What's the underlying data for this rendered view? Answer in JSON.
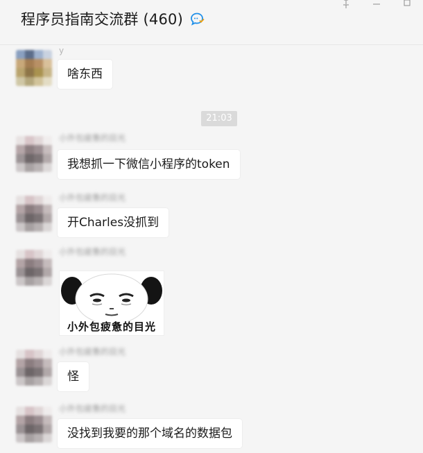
{
  "header": {
    "title": "程序员指南交流群",
    "member_count": "(460)",
    "icons": [
      "chat-bubble-icon",
      "pin-icon",
      "minimize-icon",
      "maximize-icon"
    ]
  },
  "timestamp": "21:03",
  "messages": [
    {
      "sender": "y",
      "text": "啥东西"
    },
    {
      "sender": "小外包疲惫的目光",
      "text": "我想抓一下微信小程序的token"
    },
    {
      "sender": "小外包疲惫的目光",
      "text": "开Charles没抓到"
    },
    {
      "sender": "小外包疲惫的目光",
      "sticker_caption": "小外包疲惫的目光"
    },
    {
      "sender": "小外包疲惫的目光",
      "text": "怪"
    },
    {
      "sender": "小外包疲惫的目光",
      "text": "没找到我要的那个域名的数据包"
    }
  ],
  "colors": {
    "background": "#f5f5f5",
    "bubble": "#ffffff",
    "timestamp_bg": "#dadada",
    "accent_blue": "#1f8fe8"
  }
}
